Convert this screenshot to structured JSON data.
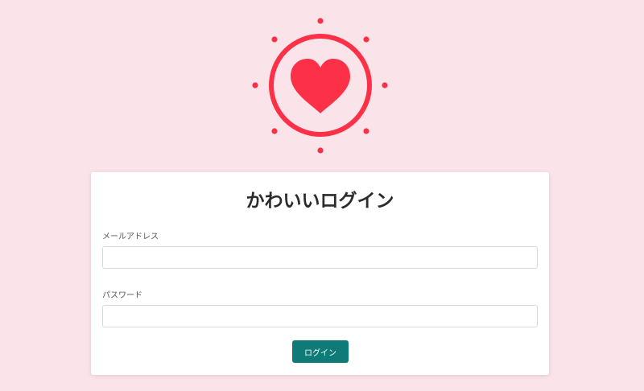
{
  "colors": {
    "background": "#fbe3ea",
    "accent": "#fc3148",
    "button": "#0e7b78"
  },
  "logo": {
    "icon": "heart-sun-icon"
  },
  "login_form": {
    "title": "かわいいログイン",
    "email_label": "メールアドレス",
    "email_value": "",
    "password_label": "パスワード",
    "password_value": "",
    "submit_label": "ログイン"
  }
}
